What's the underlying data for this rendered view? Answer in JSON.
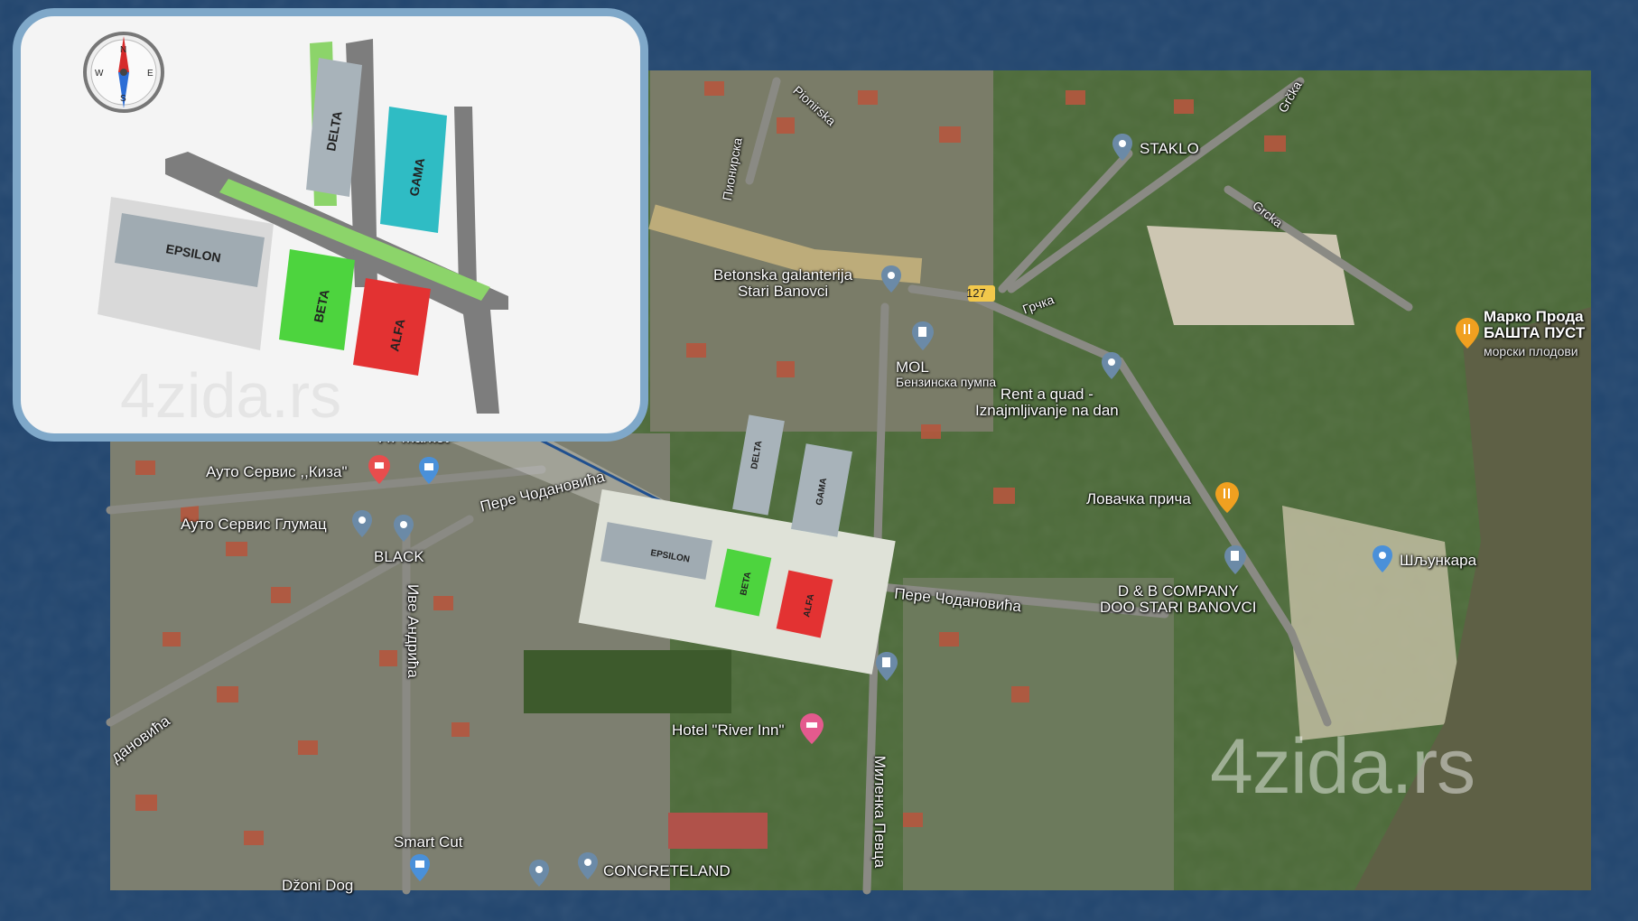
{
  "inset": {
    "compass": {
      "n": "N",
      "s": "S",
      "e": "E",
      "w": "W"
    },
    "buildings": {
      "delta": "DELTA",
      "gama": "GAMA",
      "epsilon": "EPSILON",
      "beta": "BETA",
      "alfa": "ALFA"
    },
    "watermark": "4zida.rs"
  },
  "map": {
    "streets": {
      "pionirska": "Pionirska",
      "pionirska_cyr": "Пионирска",
      "grcka_top": "Grčka",
      "grcka_mid": "Grcka",
      "grcka_low": "Грчка",
      "road_number": "127",
      "pere1": "Пере Чодановића",
      "pere2": "Пере Чодановића",
      "ive": "Иве Андрића",
      "milenka": "Миленка Певца",
      "dan": "дановића"
    },
    "places": {
      "staklo": "STAKLO",
      "betonska": "Betonska galanterija\nStari Banovci",
      "mol": "MOL",
      "mol_sub": "Бензинска пумпа",
      "rent": "Rent a quad -\nIznajmljivanje na dan",
      "marko": "Марко Прода",
      "basta": "БАШТА ПУСТ",
      "morski": "морски плодови",
      "lovacka": "Ловачка прича",
      "db": "D & B COMPANY\nDOO STARI BANOVCI",
      "sljunkara": "Шљункара",
      "kiza": "Ауто Сервис ,,Киза\"",
      "glumac": "Ауто Сервис Глумац",
      "black": "BLACK",
      "market": "AT market",
      "hotel": "Hotel \"River Inn\"",
      "smart": "Smart Cut",
      "concrete": "CONCRETELAND",
      "dzoni": "Džoni Dog"
    },
    "watermark": "4zida.rs"
  },
  "colors": {
    "background": "#22466f",
    "alfa": "#e33232",
    "beta": "#4dd43e",
    "gama": "#2fbcc4",
    "delta": "#a8b3ba",
    "epsilon": "#a0abb2"
  }
}
